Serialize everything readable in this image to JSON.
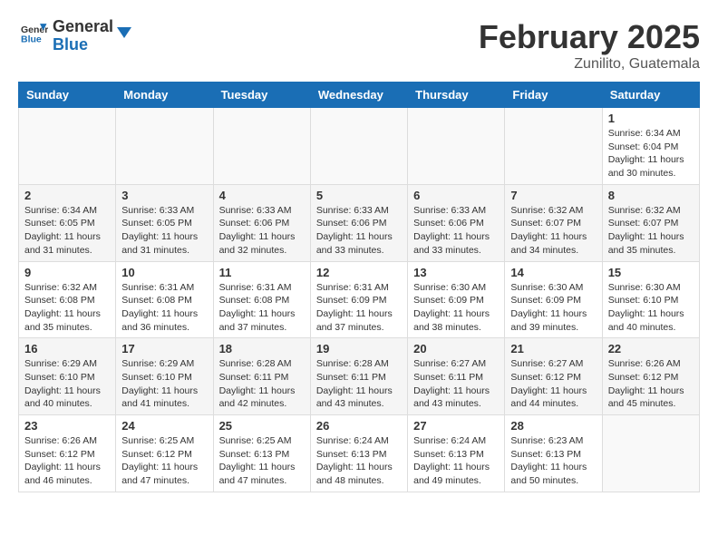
{
  "header": {
    "logo_text_general": "General",
    "logo_text_blue": "Blue",
    "month": "February 2025",
    "location": "Zunilito, Guatemala"
  },
  "weekdays": [
    "Sunday",
    "Monday",
    "Tuesday",
    "Wednesday",
    "Thursday",
    "Friday",
    "Saturday"
  ],
  "weeks": [
    [
      {
        "day": "",
        "info": ""
      },
      {
        "day": "",
        "info": ""
      },
      {
        "day": "",
        "info": ""
      },
      {
        "day": "",
        "info": ""
      },
      {
        "day": "",
        "info": ""
      },
      {
        "day": "",
        "info": ""
      },
      {
        "day": "1",
        "info": "Sunrise: 6:34 AM\nSunset: 6:04 PM\nDaylight: 11 hours\nand 30 minutes."
      }
    ],
    [
      {
        "day": "2",
        "info": "Sunrise: 6:34 AM\nSunset: 6:05 PM\nDaylight: 11 hours\nand 31 minutes."
      },
      {
        "day": "3",
        "info": "Sunrise: 6:33 AM\nSunset: 6:05 PM\nDaylight: 11 hours\nand 31 minutes."
      },
      {
        "day": "4",
        "info": "Sunrise: 6:33 AM\nSunset: 6:06 PM\nDaylight: 11 hours\nand 32 minutes."
      },
      {
        "day": "5",
        "info": "Sunrise: 6:33 AM\nSunset: 6:06 PM\nDaylight: 11 hours\nand 33 minutes."
      },
      {
        "day": "6",
        "info": "Sunrise: 6:33 AM\nSunset: 6:06 PM\nDaylight: 11 hours\nand 33 minutes."
      },
      {
        "day": "7",
        "info": "Sunrise: 6:32 AM\nSunset: 6:07 PM\nDaylight: 11 hours\nand 34 minutes."
      },
      {
        "day": "8",
        "info": "Sunrise: 6:32 AM\nSunset: 6:07 PM\nDaylight: 11 hours\nand 35 minutes."
      }
    ],
    [
      {
        "day": "9",
        "info": "Sunrise: 6:32 AM\nSunset: 6:08 PM\nDaylight: 11 hours\nand 35 minutes."
      },
      {
        "day": "10",
        "info": "Sunrise: 6:31 AM\nSunset: 6:08 PM\nDaylight: 11 hours\nand 36 minutes."
      },
      {
        "day": "11",
        "info": "Sunrise: 6:31 AM\nSunset: 6:08 PM\nDaylight: 11 hours\nand 37 minutes."
      },
      {
        "day": "12",
        "info": "Sunrise: 6:31 AM\nSunset: 6:09 PM\nDaylight: 11 hours\nand 37 minutes."
      },
      {
        "day": "13",
        "info": "Sunrise: 6:30 AM\nSunset: 6:09 PM\nDaylight: 11 hours\nand 38 minutes."
      },
      {
        "day": "14",
        "info": "Sunrise: 6:30 AM\nSunset: 6:09 PM\nDaylight: 11 hours\nand 39 minutes."
      },
      {
        "day": "15",
        "info": "Sunrise: 6:30 AM\nSunset: 6:10 PM\nDaylight: 11 hours\nand 40 minutes."
      }
    ],
    [
      {
        "day": "16",
        "info": "Sunrise: 6:29 AM\nSunset: 6:10 PM\nDaylight: 11 hours\nand 40 minutes."
      },
      {
        "day": "17",
        "info": "Sunrise: 6:29 AM\nSunset: 6:10 PM\nDaylight: 11 hours\nand 41 minutes."
      },
      {
        "day": "18",
        "info": "Sunrise: 6:28 AM\nSunset: 6:11 PM\nDaylight: 11 hours\nand 42 minutes."
      },
      {
        "day": "19",
        "info": "Sunrise: 6:28 AM\nSunset: 6:11 PM\nDaylight: 11 hours\nand 43 minutes."
      },
      {
        "day": "20",
        "info": "Sunrise: 6:27 AM\nSunset: 6:11 PM\nDaylight: 11 hours\nand 43 minutes."
      },
      {
        "day": "21",
        "info": "Sunrise: 6:27 AM\nSunset: 6:12 PM\nDaylight: 11 hours\nand 44 minutes."
      },
      {
        "day": "22",
        "info": "Sunrise: 6:26 AM\nSunset: 6:12 PM\nDaylight: 11 hours\nand 45 minutes."
      }
    ],
    [
      {
        "day": "23",
        "info": "Sunrise: 6:26 AM\nSunset: 6:12 PM\nDaylight: 11 hours\nand 46 minutes."
      },
      {
        "day": "24",
        "info": "Sunrise: 6:25 AM\nSunset: 6:12 PM\nDaylight: 11 hours\nand 47 minutes."
      },
      {
        "day": "25",
        "info": "Sunrise: 6:25 AM\nSunset: 6:13 PM\nDaylight: 11 hours\nand 47 minutes."
      },
      {
        "day": "26",
        "info": "Sunrise: 6:24 AM\nSunset: 6:13 PM\nDaylight: 11 hours\nand 48 minutes."
      },
      {
        "day": "27",
        "info": "Sunrise: 6:24 AM\nSunset: 6:13 PM\nDaylight: 11 hours\nand 49 minutes."
      },
      {
        "day": "28",
        "info": "Sunrise: 6:23 AM\nSunset: 6:13 PM\nDaylight: 11 hours\nand 50 minutes."
      },
      {
        "day": "",
        "info": ""
      }
    ]
  ]
}
